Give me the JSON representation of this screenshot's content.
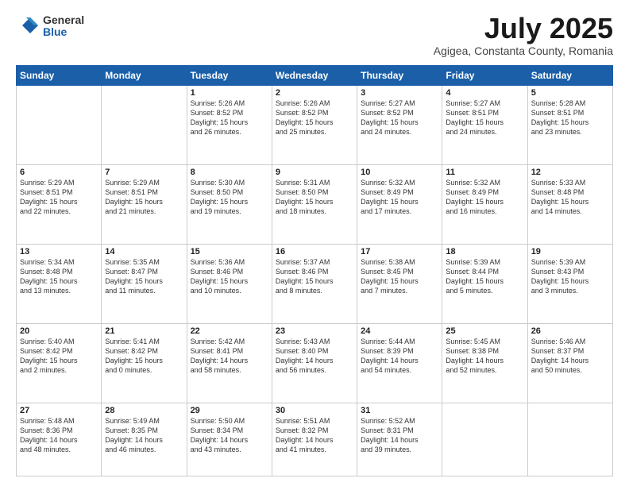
{
  "logo": {
    "general": "General",
    "blue": "Blue"
  },
  "title": {
    "month": "July 2025",
    "location": "Agigea, Constanta County, Romania"
  },
  "weekdays": [
    "Sunday",
    "Monday",
    "Tuesday",
    "Wednesday",
    "Thursday",
    "Friday",
    "Saturday"
  ],
  "weeks": [
    [
      {
        "day": "",
        "info": ""
      },
      {
        "day": "",
        "info": ""
      },
      {
        "day": "1",
        "info": "Sunrise: 5:26 AM\nSunset: 8:52 PM\nDaylight: 15 hours\nand 26 minutes."
      },
      {
        "day": "2",
        "info": "Sunrise: 5:26 AM\nSunset: 8:52 PM\nDaylight: 15 hours\nand 25 minutes."
      },
      {
        "day": "3",
        "info": "Sunrise: 5:27 AM\nSunset: 8:52 PM\nDaylight: 15 hours\nand 24 minutes."
      },
      {
        "day": "4",
        "info": "Sunrise: 5:27 AM\nSunset: 8:51 PM\nDaylight: 15 hours\nand 24 minutes."
      },
      {
        "day": "5",
        "info": "Sunrise: 5:28 AM\nSunset: 8:51 PM\nDaylight: 15 hours\nand 23 minutes."
      }
    ],
    [
      {
        "day": "6",
        "info": "Sunrise: 5:29 AM\nSunset: 8:51 PM\nDaylight: 15 hours\nand 22 minutes."
      },
      {
        "day": "7",
        "info": "Sunrise: 5:29 AM\nSunset: 8:51 PM\nDaylight: 15 hours\nand 21 minutes."
      },
      {
        "day": "8",
        "info": "Sunrise: 5:30 AM\nSunset: 8:50 PM\nDaylight: 15 hours\nand 19 minutes."
      },
      {
        "day": "9",
        "info": "Sunrise: 5:31 AM\nSunset: 8:50 PM\nDaylight: 15 hours\nand 18 minutes."
      },
      {
        "day": "10",
        "info": "Sunrise: 5:32 AM\nSunset: 8:49 PM\nDaylight: 15 hours\nand 17 minutes."
      },
      {
        "day": "11",
        "info": "Sunrise: 5:32 AM\nSunset: 8:49 PM\nDaylight: 15 hours\nand 16 minutes."
      },
      {
        "day": "12",
        "info": "Sunrise: 5:33 AM\nSunset: 8:48 PM\nDaylight: 15 hours\nand 14 minutes."
      }
    ],
    [
      {
        "day": "13",
        "info": "Sunrise: 5:34 AM\nSunset: 8:48 PM\nDaylight: 15 hours\nand 13 minutes."
      },
      {
        "day": "14",
        "info": "Sunrise: 5:35 AM\nSunset: 8:47 PM\nDaylight: 15 hours\nand 11 minutes."
      },
      {
        "day": "15",
        "info": "Sunrise: 5:36 AM\nSunset: 8:46 PM\nDaylight: 15 hours\nand 10 minutes."
      },
      {
        "day": "16",
        "info": "Sunrise: 5:37 AM\nSunset: 8:46 PM\nDaylight: 15 hours\nand 8 minutes."
      },
      {
        "day": "17",
        "info": "Sunrise: 5:38 AM\nSunset: 8:45 PM\nDaylight: 15 hours\nand 7 minutes."
      },
      {
        "day": "18",
        "info": "Sunrise: 5:39 AM\nSunset: 8:44 PM\nDaylight: 15 hours\nand 5 minutes."
      },
      {
        "day": "19",
        "info": "Sunrise: 5:39 AM\nSunset: 8:43 PM\nDaylight: 15 hours\nand 3 minutes."
      }
    ],
    [
      {
        "day": "20",
        "info": "Sunrise: 5:40 AM\nSunset: 8:42 PM\nDaylight: 15 hours\nand 2 minutes."
      },
      {
        "day": "21",
        "info": "Sunrise: 5:41 AM\nSunset: 8:42 PM\nDaylight: 15 hours\nand 0 minutes."
      },
      {
        "day": "22",
        "info": "Sunrise: 5:42 AM\nSunset: 8:41 PM\nDaylight: 14 hours\nand 58 minutes."
      },
      {
        "day": "23",
        "info": "Sunrise: 5:43 AM\nSunset: 8:40 PM\nDaylight: 14 hours\nand 56 minutes."
      },
      {
        "day": "24",
        "info": "Sunrise: 5:44 AM\nSunset: 8:39 PM\nDaylight: 14 hours\nand 54 minutes."
      },
      {
        "day": "25",
        "info": "Sunrise: 5:45 AM\nSunset: 8:38 PM\nDaylight: 14 hours\nand 52 minutes."
      },
      {
        "day": "26",
        "info": "Sunrise: 5:46 AM\nSunset: 8:37 PM\nDaylight: 14 hours\nand 50 minutes."
      }
    ],
    [
      {
        "day": "27",
        "info": "Sunrise: 5:48 AM\nSunset: 8:36 PM\nDaylight: 14 hours\nand 48 minutes."
      },
      {
        "day": "28",
        "info": "Sunrise: 5:49 AM\nSunset: 8:35 PM\nDaylight: 14 hours\nand 46 minutes."
      },
      {
        "day": "29",
        "info": "Sunrise: 5:50 AM\nSunset: 8:34 PM\nDaylight: 14 hours\nand 43 minutes."
      },
      {
        "day": "30",
        "info": "Sunrise: 5:51 AM\nSunset: 8:32 PM\nDaylight: 14 hours\nand 41 minutes."
      },
      {
        "day": "31",
        "info": "Sunrise: 5:52 AM\nSunset: 8:31 PM\nDaylight: 14 hours\nand 39 minutes."
      },
      {
        "day": "",
        "info": ""
      },
      {
        "day": "",
        "info": ""
      }
    ]
  ]
}
